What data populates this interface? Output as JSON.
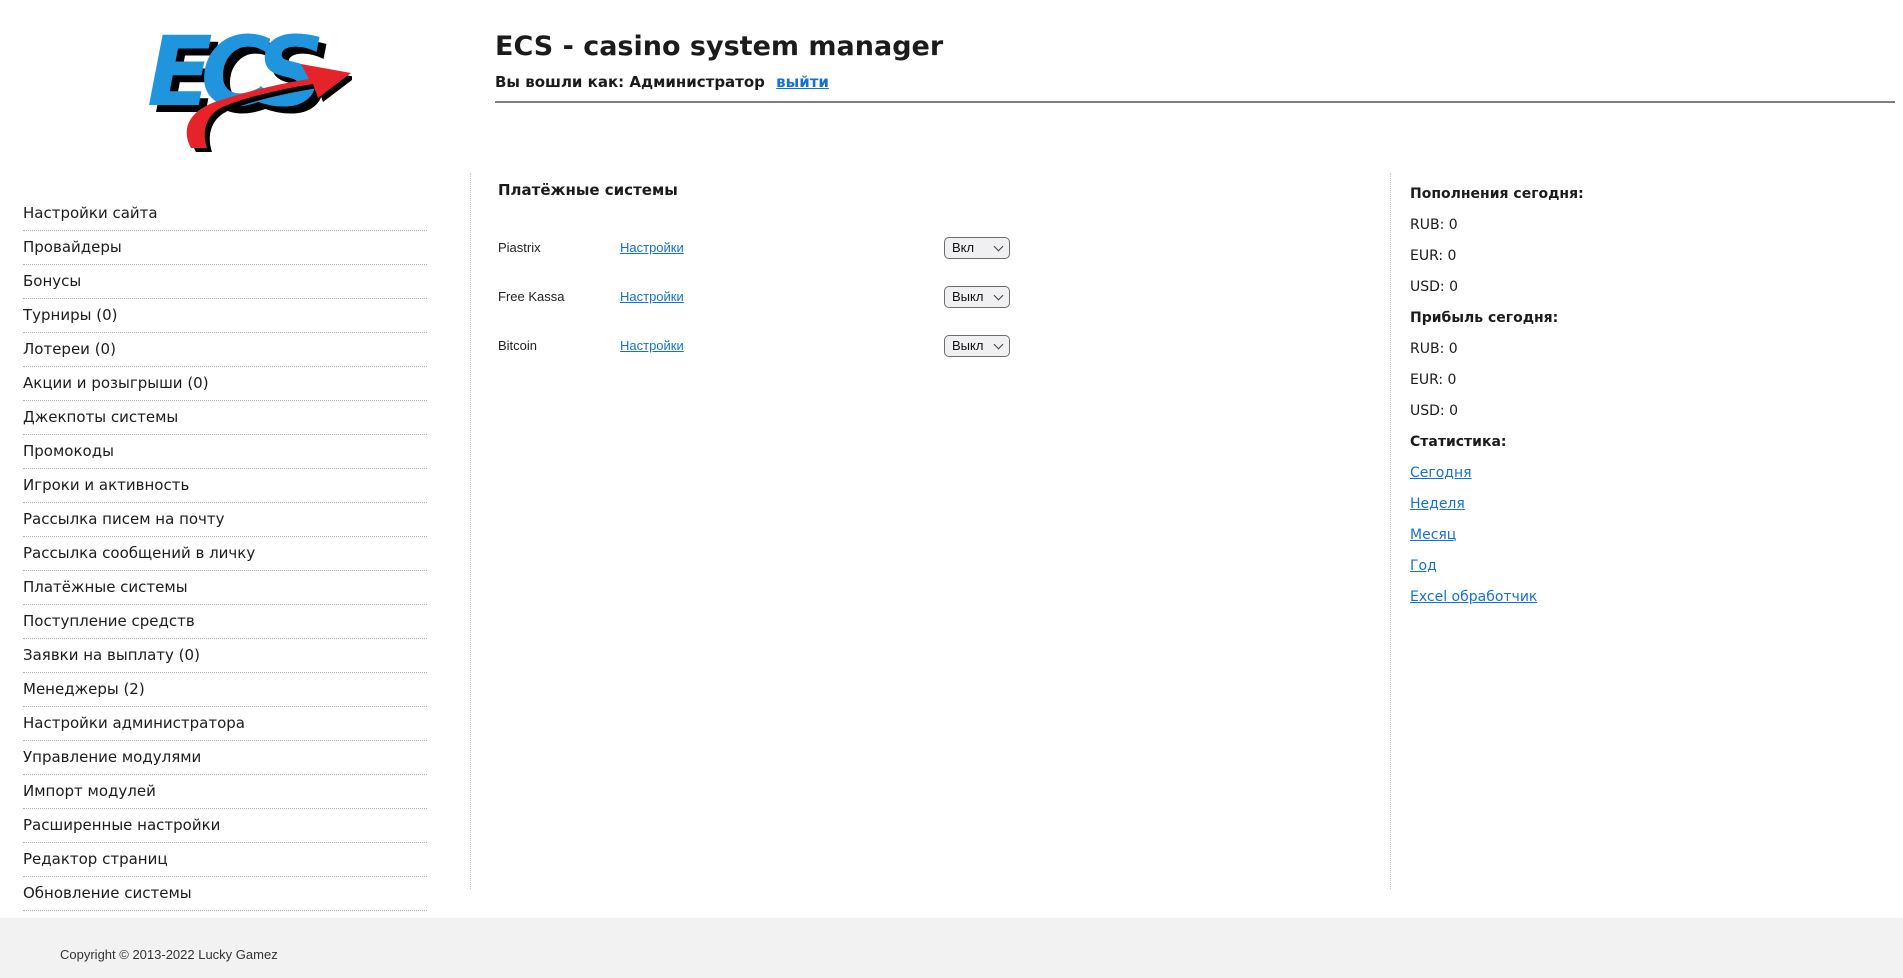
{
  "header": {
    "logo_text": "ECS",
    "title": "ECS - casino system manager",
    "login_prefix": "Вы вошли как: Администратор",
    "logout_label": "выйти"
  },
  "sidebar": {
    "items": [
      "Настройки сайта",
      "Провайдеры",
      "Бонусы",
      "Турниры (0)",
      "Лотереи (0)",
      "Акции и розыгрыши (0)",
      "Джекпоты системы",
      "Промокоды",
      "Игроки и активность",
      "Рассылка писем на почту",
      "Рассылка сообщений в личку",
      "Платёжные системы",
      "Поступление средств",
      "Заявки на выплату (0)",
      "Менеджеры (2)",
      "Настройки администратора",
      "Управление модулями",
      "Импорт модулей",
      "Расширенные настройки",
      "Редактор страниц",
      "Обновление системы"
    ]
  },
  "main": {
    "heading": "Платёжные системы",
    "settings_label": "Настройки",
    "rows": [
      {
        "name": "Piastrix",
        "state": "Вкл"
      },
      {
        "name": "Free Kassa",
        "state": "Выкл"
      },
      {
        "name": "Bitcoin",
        "state": "Выкл"
      }
    ]
  },
  "stats_panel": {
    "sections": [
      {
        "heading": "Пополнения сегодня:",
        "lines": [
          "RUB: 0",
          "EUR: 0",
          "USD: 0"
        ]
      },
      {
        "heading": "Прибыль сегодня:",
        "lines": [
          "RUB: 0",
          "EUR: 0",
          "USD: 0"
        ]
      },
      {
        "heading": "Статистика:",
        "links": [
          "Сегодня",
          "Неделя",
          "Месяц",
          "Год",
          "Excel обработчик"
        ]
      }
    ]
  },
  "footer": {
    "copyright": "Copyright © 2013-2022 Lucky Gamez"
  },
  "colors": {
    "link_blue": "#1371d6",
    "logo_blue": "#2095dd",
    "logo_red": "#e62329",
    "footer_bg": "#f2f2f2"
  }
}
